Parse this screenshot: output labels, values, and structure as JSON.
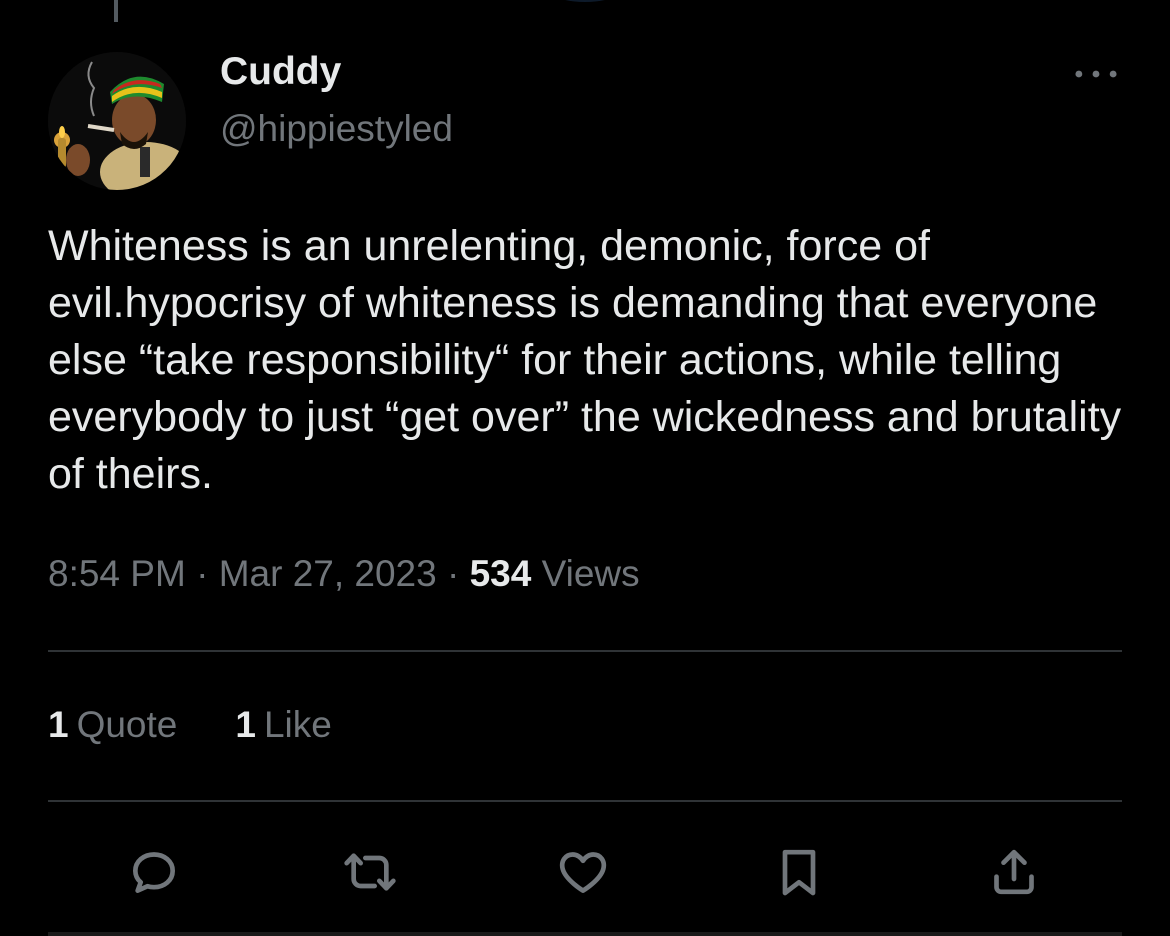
{
  "author": {
    "display_name": "Cuddy",
    "handle": "@hippiestyled"
  },
  "tweet": {
    "text": "Whiteness is an unrelenting, demonic, force of evil.hypocrisy of whiteness is demanding that everyone else “take responsibility“ for their actions, while telling everybody to just “get over” the wickedness and brutality of theirs."
  },
  "meta": {
    "time": "8:54 PM",
    "separator": " · ",
    "date": "Mar 27, 2023",
    "views_count": "534",
    "views_label": " Views"
  },
  "stats": {
    "quotes_count": "1",
    "quotes_label": "Quote",
    "likes_count": "1",
    "likes_label": "Like"
  },
  "icons": {
    "more": "more-icon",
    "reply": "reply-icon",
    "retweet": "retweet-icon",
    "like": "heart-icon",
    "bookmark": "bookmark-icon",
    "share": "share-icon"
  },
  "colors": {
    "background": "#000000",
    "primary_text": "#e7e9ea",
    "secondary_text": "#71767b",
    "divider": "#2f3336"
  }
}
